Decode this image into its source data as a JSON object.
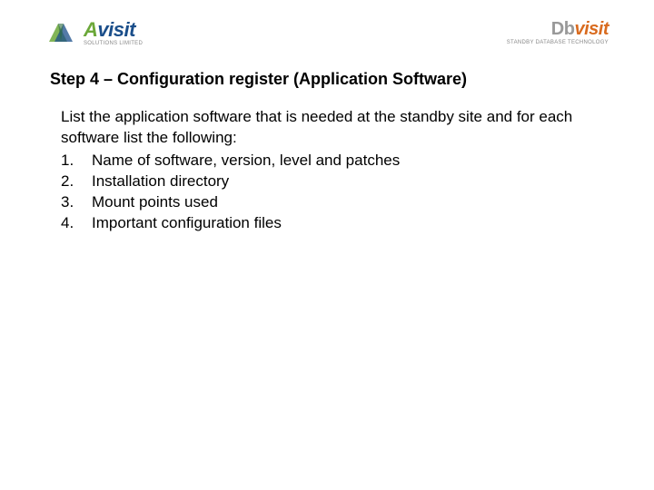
{
  "header": {
    "left_logo": {
      "name_part1": "A",
      "name_part2": "visit",
      "tagline": "SOLUTIONS LIMITED"
    },
    "right_logo": {
      "name_part1": "Db",
      "name_part2": "visit",
      "tagline": "STANDBY DATABASE TECHNOLOGY"
    }
  },
  "title": "Step 4 – Configuration register (Application Software)",
  "intro": "List the application software that is needed at the standby site and for each software list the following:",
  "items": [
    {
      "num": "1.",
      "text": "Name of software, version, level and patches"
    },
    {
      "num": "2.",
      "text": "Installation directory"
    },
    {
      "num": "3.",
      "text": "Mount points used"
    },
    {
      "num": "4.",
      "text": "Important configuration files"
    }
  ]
}
